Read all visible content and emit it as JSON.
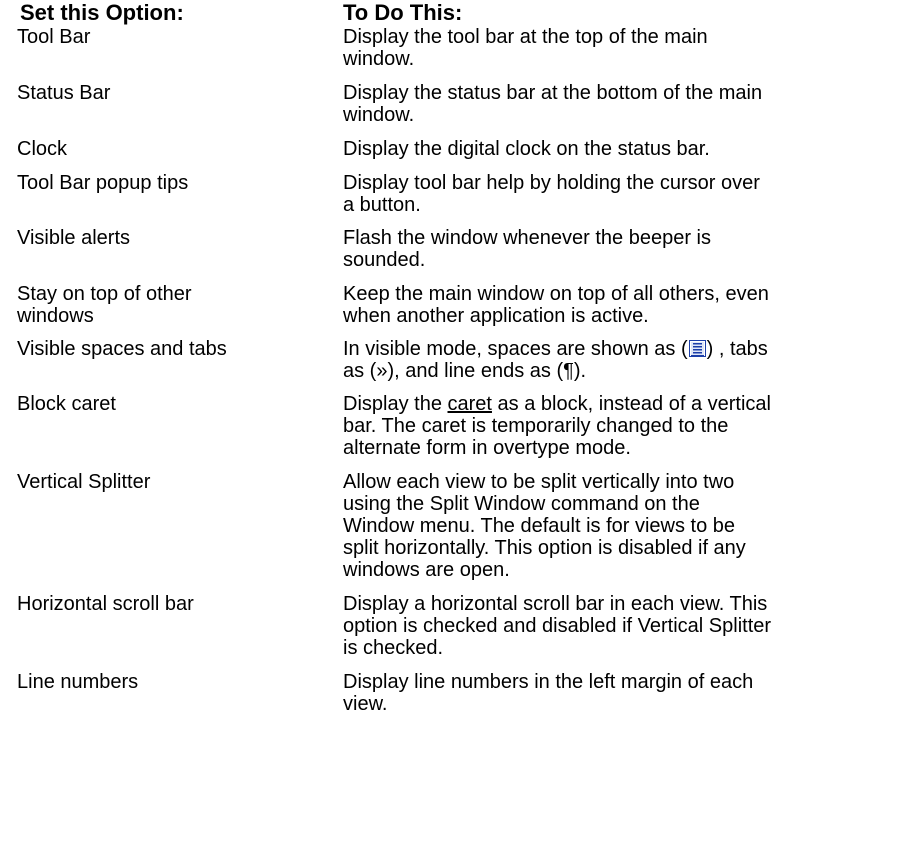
{
  "header": {
    "option": "Set this Option:",
    "action": "To Do This:"
  },
  "rows": [
    {
      "option": "Tool Bar",
      "action": "Display the tool bar at the top of the main window."
    },
    {
      "option": "Status Bar",
      "action": "Display the status bar at the bottom of the main window."
    },
    {
      "option": "Clock",
      "action": "Display the digital clock on the status bar."
    },
    {
      "option": "Tool Bar popup tips",
      "action": "Display tool bar help by holding the cursor over a button."
    },
    {
      "option": "Visible alerts",
      "action": "Flash the window whenever the beeper is sounded."
    },
    {
      "option": "Stay on top of other windows",
      "action": "Keep the main window on top of all others, even when another application is active."
    },
    {
      "option": "Visible spaces and tabs",
      "action_pre": "In visible mode, spaces are shown as (",
      "action_icon": "visible-space-icon",
      "action_post": ") , tabs as (»), and line ends as (¶)."
    },
    {
      "option": "Block caret",
      "action_pre": "Display the ",
      "action_link": "caret",
      "action_post": " as a block, instead of a vertical bar.   The caret is temporarily changed to the alternate form in overtype mode."
    },
    {
      "option": "Vertical Splitter",
      "action": "Allow each view to be split vertically into two using the Split Window command on the Window menu.   The default is for views to be split horizontally.   This option is disabled if any windows are open."
    },
    {
      "option": "Horizontal scroll bar",
      "action": "Display a horizontal scroll bar in each view.   This option is checked and disabled if Vertical Splitter is checked."
    },
    {
      "option": "Line numbers",
      "action": "Display line numbers in the left margin of each view."
    }
  ]
}
